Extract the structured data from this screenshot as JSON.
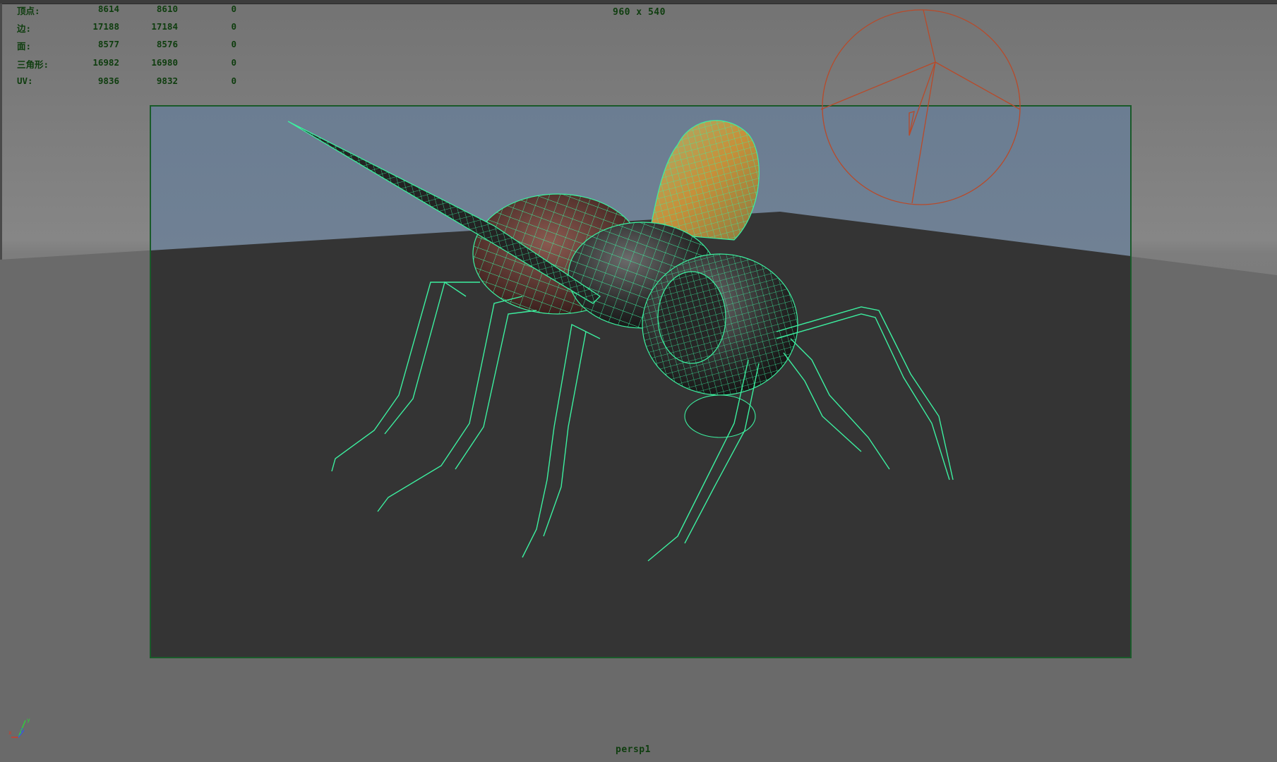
{
  "viewport": {
    "resolution_gate": "960 x 540",
    "camera_name": "persp1",
    "hud_stats": [
      {
        "label": "顶点:",
        "selected": "8614",
        "total": "8610",
        "extra": "0"
      },
      {
        "label": "边:",
        "selected": "17188",
        "total": "17184",
        "extra": "0"
      },
      {
        "label": "面:",
        "selected": "8577",
        "total": "8576",
        "extra": "0"
      },
      {
        "label": "三角形:",
        "selected": "16982",
        "total": "16980",
        "extra": "0"
      },
      {
        "label": "UV:",
        "selected": "9836",
        "total": "9832",
        "extra": "0"
      }
    ],
    "axis_indicator": {
      "x_label": "x",
      "y_label": "y",
      "z_label": "z"
    },
    "colors": {
      "hud_text": "#0e3d0e",
      "wireframe": "#3cf0a0",
      "gate_border": "#1a5a2a",
      "light_gizmo": "#b84a2a",
      "background_sky": "#6f8296",
      "ground": "#343434"
    }
  }
}
